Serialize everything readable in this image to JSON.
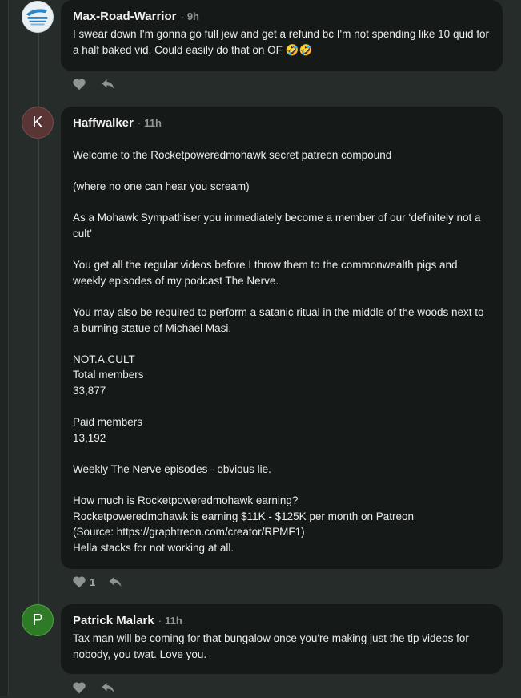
{
  "comments": [
    {
      "author": "Max-Road-Warrior",
      "time": "9h",
      "body": [
        "I swear down I'm gonna go full jew and get a refund bc I'm not spending like 10 quid for a half baked vid. Could easily do that on OF 🤣🤣"
      ],
      "likes": ""
    },
    {
      "author": "Haffwalker",
      "avatar_letter": "K",
      "time": "11h",
      "body": [
        "Welcome to the Rocketpoweredmohawk secret patreon compound",
        "(where no one can hear you scream)",
        "As a Mohawk Sympathiser you immediately become a member of our ‘definitely not a cult’",
        "You get all the regular videos before I throw them to the commonwealth pigs and weekly episodes of my podcast The Nerve.",
        "You may also be required to perform a satanic ritual in the middle of the woods next to a burning statue of Michael Masi.",
        "NOT.A.CULT\nTotal members\n33,877",
        "Paid members\n13,192",
        "Weekly The Nerve episodes - obvious lie.",
        "How much is Rocketpoweredmohawk earning?\nRocketpoweredmohawk is earning $11K - $125K per month on Patreon\n(Source: https://graphtreon.com/creator/RPMF1)\nHella stacks for not working at all."
      ],
      "likes": "1"
    },
    {
      "author": "Patrick Malark",
      "avatar_letter": "P",
      "time": "11h",
      "body": [
        "Tax man will be coming for that bungalow once you're making just the tip videos for nobody, you twat. Love you."
      ],
      "likes": ""
    }
  ],
  "colors": {
    "page_bg": "#252c2a",
    "bubble_bg": "#151a19",
    "avatar_k": "#5a3536",
    "avatar_p": "#2f7a26"
  },
  "icons": [
    "heart-icon",
    "reply-icon"
  ]
}
